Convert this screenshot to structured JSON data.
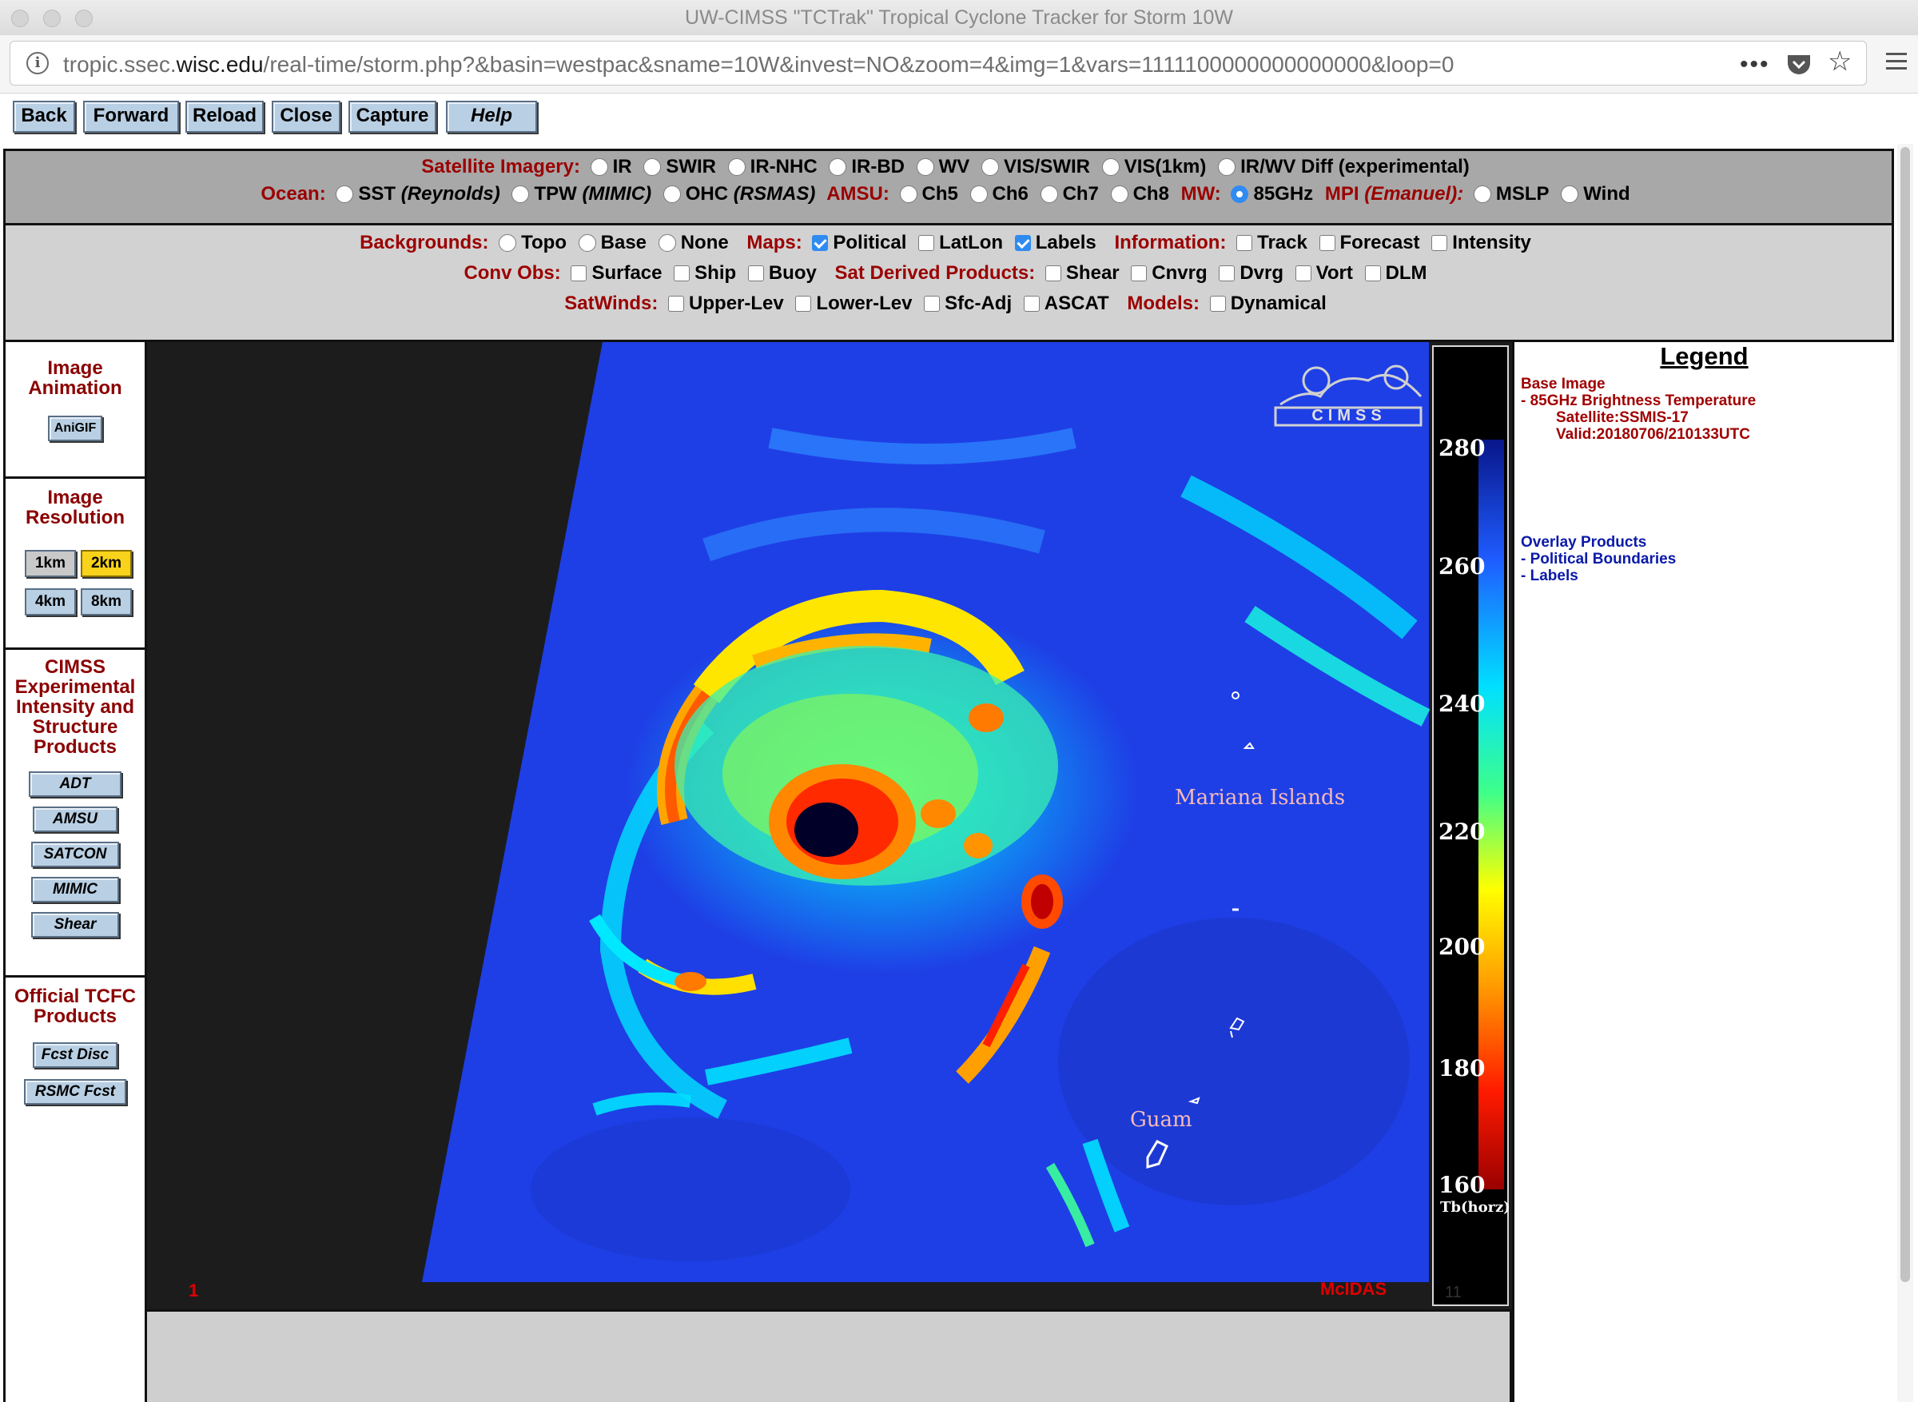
{
  "window": {
    "title": "UW-CIMSS \"TCTrak\" Tropical Cyclone Tracker for Storm 10W"
  },
  "browser": {
    "url_prefix": "tropic.ssec.",
    "url_domain": "wisc.edu",
    "url_path": "/real-time/storm.php?&basin=westpac&sname=10W&invest=NO&zoom=4&img=1&vars=1111100000000000000&loop=0",
    "icons": [
      "info-icon",
      "more-icon",
      "pocket-icon",
      "bookmark-star-icon",
      "hamburger-menu-icon"
    ]
  },
  "nav_buttons": [
    "Back",
    "Forward",
    "Reload",
    "Close",
    "Capture",
    "Help"
  ],
  "controls": {
    "satellite_imagery": {
      "label": "Satellite Imagery:",
      "options": [
        "IR",
        "SWIR",
        "IR-NHC",
        "IR-BD",
        "WV",
        "VIS/SWIR",
        "VIS(1km)",
        "IR/WV Diff (experimental)"
      ]
    },
    "ocean": {
      "label": "Ocean:",
      "sst": "SST",
      "sst_src": "(Reynolds)",
      "tpw": "TPW",
      "tpw_src": "(MIMIC)",
      "ohc": "OHC",
      "ohc_src": "(RSMAS)"
    },
    "amsu": {
      "label": "AMSU:",
      "options": [
        "Ch5",
        "Ch6",
        "Ch7",
        "Ch8"
      ]
    },
    "mw": {
      "label": "MW:",
      "options": [
        "85GHz"
      ],
      "selected": "85GHz"
    },
    "mpi": {
      "label": "MPI",
      "label_src": "(Emanuel):",
      "options": [
        "MSLP",
        "Wind"
      ]
    },
    "backgrounds": {
      "label": "Backgrounds:",
      "options": [
        "Topo",
        "Base",
        "None"
      ]
    },
    "maps": {
      "label": "Maps:",
      "options": [
        "Political",
        "LatLon",
        "Labels"
      ],
      "checked": [
        "Political",
        "Labels"
      ]
    },
    "information": {
      "label": "Information:",
      "options": [
        "Track",
        "Forecast",
        "Intensity"
      ]
    },
    "conv_obs": {
      "label": "Conv Obs:",
      "options": [
        "Surface",
        "Ship",
        "Buoy"
      ]
    },
    "sat_derived": {
      "label": "Sat Derived Products:",
      "options": [
        "Shear",
        "Cnvrg",
        "Dvrg",
        "Vort",
        "DLM"
      ]
    },
    "satwinds": {
      "label": "SatWinds:",
      "options": [
        "Upper-Lev",
        "Lower-Lev",
        "Sfc-Adj",
        "ASCAT"
      ]
    },
    "models": {
      "label": "Models:",
      "options": [
        "Dynamical"
      ]
    }
  },
  "sidebar": {
    "animation": {
      "title": "Image Animation",
      "button": "AniGIF"
    },
    "resolution": {
      "title": "Image Resolution",
      "options": [
        "1km",
        "2km",
        "4km",
        "8km"
      ],
      "selected": "2km"
    },
    "cimss": {
      "title": "CIMSS Experimental Intensity and Structure Products",
      "buttons": [
        "ADT",
        "AMSU",
        "SATCON",
        "MIMIC",
        "Shear"
      ]
    },
    "tcfc": {
      "title": "Official TCFC Products",
      "buttons": [
        "Fcst Disc",
        "RSMC Fcst"
      ]
    }
  },
  "image": {
    "logo": "CIMSS",
    "labels": [
      "Mariana Islands",
      "Guam"
    ],
    "frame_number": "1",
    "watermark": "McIDAS",
    "colorbar_ticks": [
      "280",
      "260",
      "240",
      "220",
      "200",
      "180",
      "160"
    ],
    "colorbar_unit": "Tb(horz)",
    "colorbar_corner": "11"
  },
  "legend": {
    "title": "Legend",
    "base_heading": "Base Image",
    "base_item": "-  85GHz Brightness Temperature",
    "satellite": "Satellite:SSMIS-17",
    "valid": "Valid:20180706/210133UTC",
    "overlay_heading": "Overlay Products",
    "overlay_items": [
      "-  Political Boundaries",
      "-  Labels"
    ]
  },
  "colors": {
    "button_blue": "#b9cfe3",
    "label_red": "#9b0000",
    "selected_yellow": "#f8d21b",
    "radio_blue": "#2f8bf0"
  }
}
